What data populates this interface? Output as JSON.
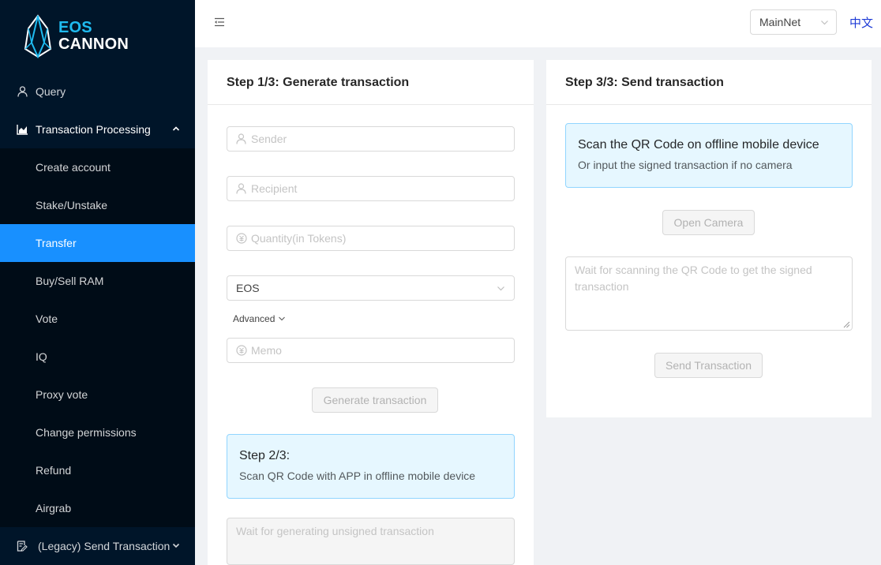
{
  "brand": {
    "line1": "EOS",
    "line2": "CANNON"
  },
  "sidebar": {
    "query": {
      "label": "Query",
      "icon": "user-icon"
    },
    "transaction_processing": {
      "label": "Transaction Processing",
      "icon": "area-chart-icon"
    },
    "sub_items": [
      {
        "label": "Create account"
      },
      {
        "label": "Stake/Unstake"
      },
      {
        "label": "Transfer",
        "selected": true
      },
      {
        "label": "Buy/Sell RAM"
      },
      {
        "label": "Vote"
      },
      {
        "label": "IQ"
      },
      {
        "label": "Proxy vote"
      },
      {
        "label": "Change permissions"
      },
      {
        "label": "Refund"
      },
      {
        "label": "Airgrab"
      }
    ],
    "legacy": {
      "label": "(Legacy) Send Transaction",
      "icon": "form-icon"
    }
  },
  "header": {
    "network": "MainNet",
    "language_link": "中文"
  },
  "step1": {
    "title": "Step 1/3: Generate transaction",
    "sender_placeholder": "Sender",
    "recipient_placeholder": "Recipient",
    "quantity_placeholder": "Quantity(in Tokens)",
    "token": "EOS",
    "advanced": "Advanced",
    "memo_placeholder": "Memo",
    "generate_button": "Generate transaction"
  },
  "step2": {
    "title": "Step 2/3:",
    "description": "Scan QR Code with APP in offline mobile device",
    "textarea_placeholder": "Wait for generating unsigned transaction"
  },
  "step3": {
    "title": "Step 3/3: Send transaction",
    "info_title": "Scan the QR Code on offline mobile device",
    "info_desc": "Or input the signed transaction if no camera",
    "open_camera_button": "Open Camera",
    "textarea_placeholder": "Wait for scanning the QR Code to get the signed transaction",
    "send_button": "Send Transaction"
  },
  "colors": {
    "sidebar_bg": "#001529",
    "submenu_bg": "#000c17",
    "accent": "#1890ff",
    "logo_cyan": "#1fbbf0",
    "info_bg": "#e6f7ff",
    "info_border": "#91d5ff"
  }
}
